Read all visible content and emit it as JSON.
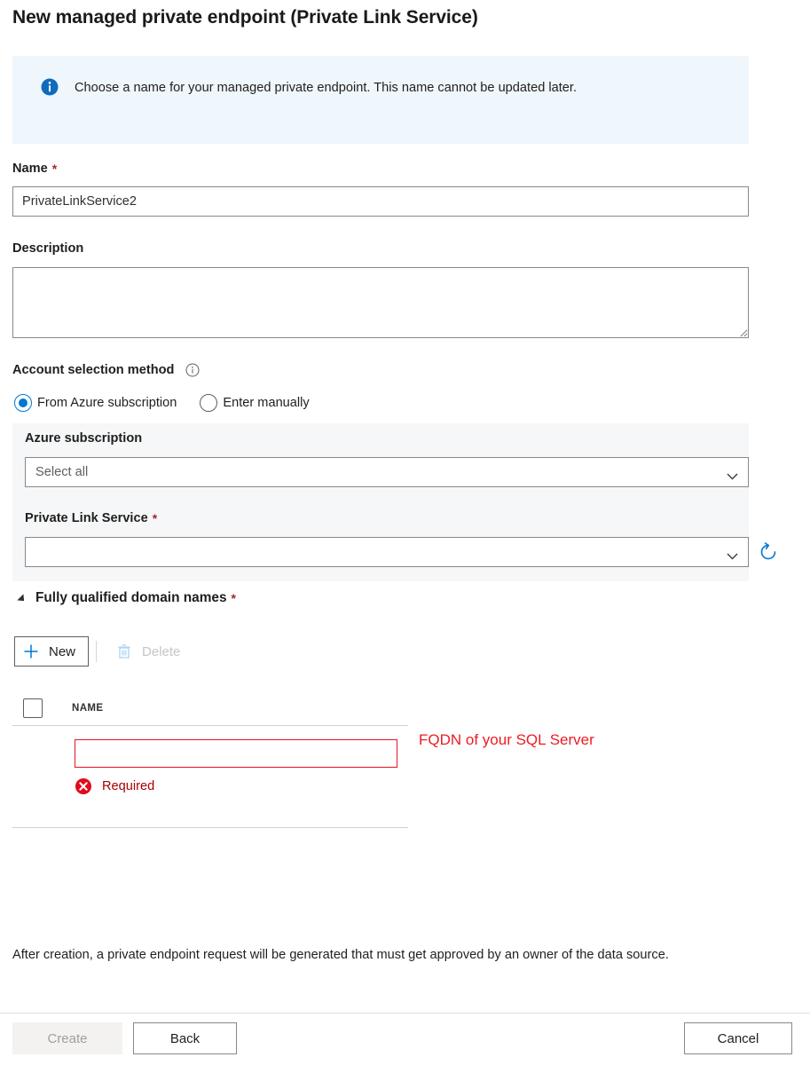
{
  "title": "New managed private endpoint (Private Link Service)",
  "info_banner": {
    "icon": "info-filled-icon",
    "text": "Choose a name for your managed private endpoint. This name cannot be updated later.",
    "background_color": "#eff6fc",
    "icon_color": "#0078d4"
  },
  "form": {
    "name": {
      "label": "Name",
      "required_marker": "*",
      "value": "PrivateLinkService2",
      "placeholder": ""
    },
    "description": {
      "label": "Description",
      "value": "",
      "placeholder": ""
    },
    "account_selection": {
      "label": "Account selection method",
      "info_icon": "info-outline-icon",
      "options": [
        {
          "label": "From Azure subscription",
          "selected": true
        },
        {
          "label": "Enter manually",
          "selected": false
        }
      ]
    },
    "azure_subscription": {
      "label": "Azure subscription",
      "value": "Select all",
      "chevron": "chevron-down-icon"
    },
    "private_link_service": {
      "label": "Private Link Service",
      "required_marker": "*",
      "value": "",
      "chevron": "chevron-down-icon",
      "refresh_icon": "refresh-icon",
      "refresh_color": "#0078d4"
    }
  },
  "fqdn_section": {
    "title": "Fully qualified domain names",
    "required_marker": "*",
    "expanded": true,
    "toolbar": {
      "new_label": "New",
      "new_icon": "plus-icon",
      "delete_label": "Delete",
      "delete_icon": "trash-icon",
      "delete_disabled": true
    },
    "table": {
      "columns": [
        "NAME"
      ],
      "rows": [
        {
          "value": "",
          "error": "Required",
          "error_icon": "error-circle-icon",
          "error_color": "#a80000",
          "border_color": "#e81123"
        }
      ]
    },
    "annotation": {
      "text": "FQDN of your SQL Server",
      "color": "#ec1c24"
    }
  },
  "footer": {
    "note": "After creation, a private endpoint request will be generated that must get approved by an owner of the data source.",
    "buttons": {
      "create": "Create",
      "back": "Back",
      "cancel": "Cancel"
    }
  }
}
